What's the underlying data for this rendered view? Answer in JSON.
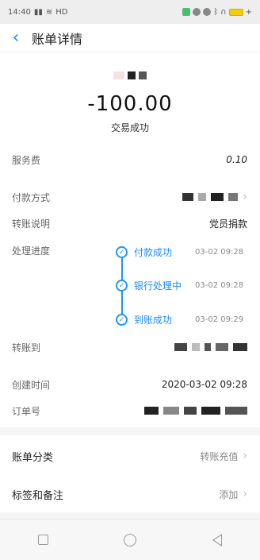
{
  "status_bar": {
    "time": "14:40",
    "network": "HD"
  },
  "nav": {
    "back_icon": "chevron-left-icon",
    "title": "账单详情"
  },
  "summary": {
    "amount": "-100.00",
    "status": "交易成功"
  },
  "details": {
    "service_fee_label": "服务费",
    "service_fee_value": "0.10",
    "payment_method_label": "付款方式",
    "transfer_note_label": "转账说明",
    "transfer_note_value": "党员捐款",
    "progress_label": "处理进度",
    "transfer_to_label": "转账到",
    "created_time_label": "创建时间",
    "created_time_value": "2020-03-02 09:28",
    "order_no_label": "订单号"
  },
  "progress": [
    {
      "label": "付款成功",
      "time": "03-02 09:28"
    },
    {
      "label": "银行处理中",
      "time": "03-02 09:28"
    },
    {
      "label": "到账成功",
      "time": "03-02 09:29"
    }
  ],
  "actions": {
    "category_label": "账单分类",
    "category_value": "转账充值",
    "tags_label": "标签和备注",
    "tags_value": "添加"
  },
  "colors": {
    "accent": "#1a8cff",
    "timeline": "#2196f3"
  }
}
